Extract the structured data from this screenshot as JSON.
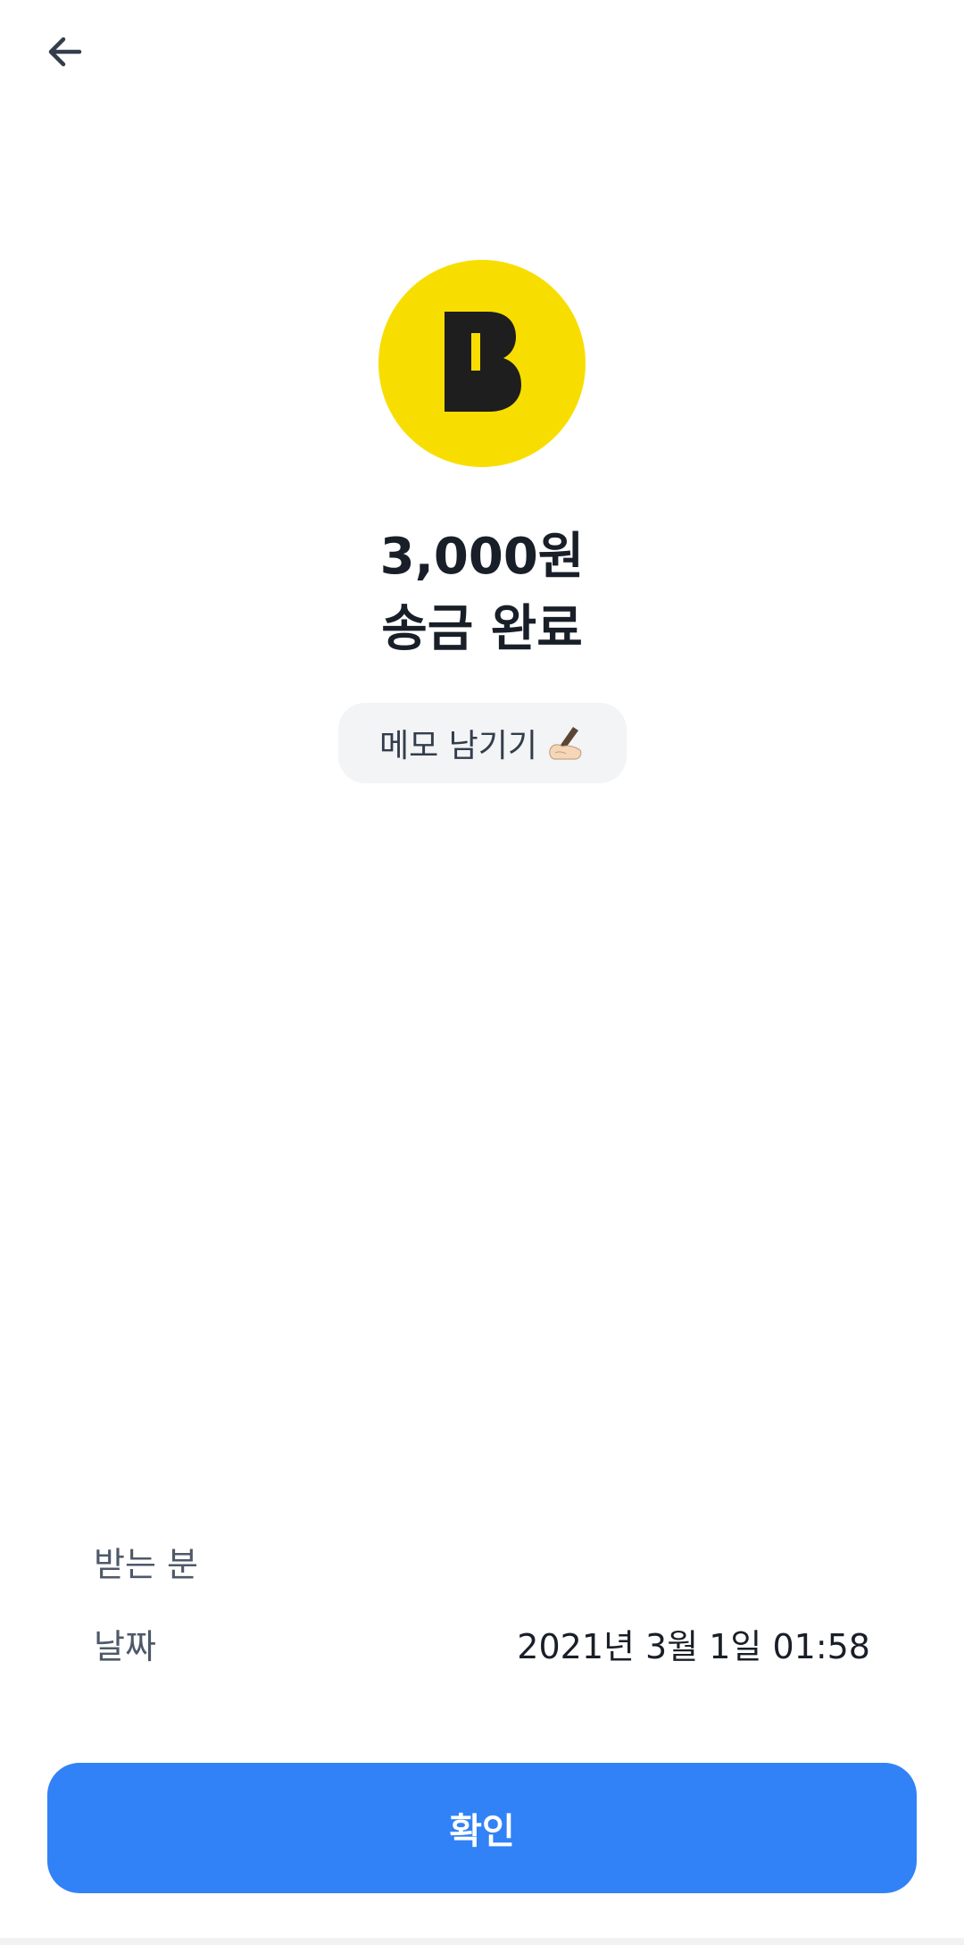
{
  "header": {
    "back_icon": "arrow-left-icon"
  },
  "logo": {
    "icon": "bank-b-logo",
    "bg_color": "#f7de00",
    "fg_color": "#1e1e1e"
  },
  "result": {
    "amount": "3,000원",
    "status": "송금 완료"
  },
  "memo": {
    "label": "메모 남기기",
    "icon": "writing-hand-icon"
  },
  "details": {
    "recipient_label": "받는 분",
    "recipient_value": "",
    "date_label": "날짜",
    "date_value": "2021년 3월 1일 01:58"
  },
  "actions": {
    "confirm_label": "확인",
    "confirm_color": "#3182f6"
  }
}
